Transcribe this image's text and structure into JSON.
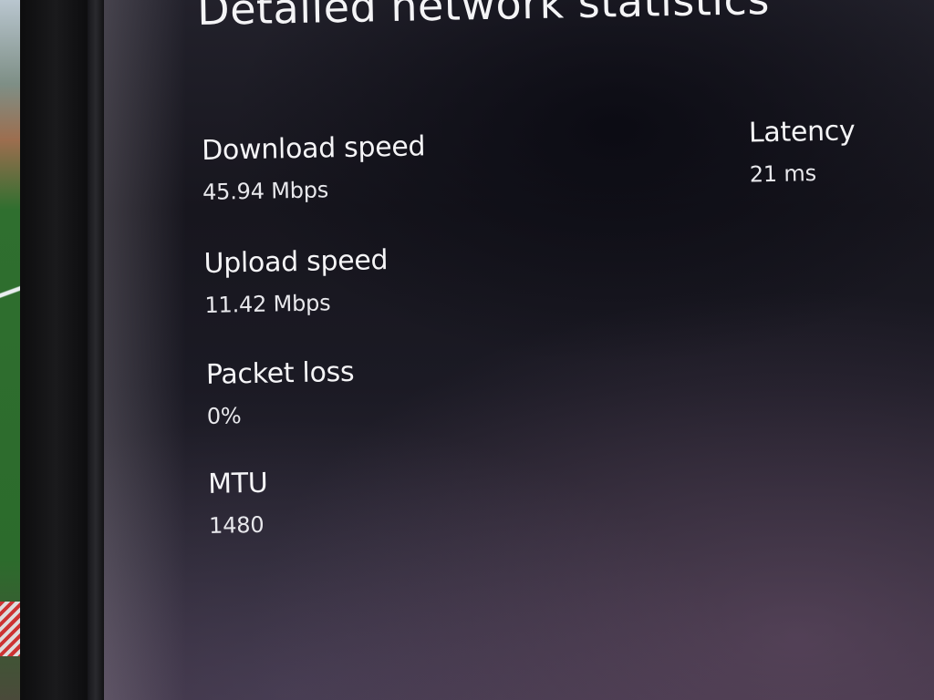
{
  "page": {
    "title": "Detailed network statistics"
  },
  "stats": {
    "download": {
      "label": "Download speed",
      "value": "45.94 Mbps"
    },
    "upload": {
      "label": "Upload speed",
      "value": "11.42 Mbps"
    },
    "packet_loss": {
      "label": "Packet loss",
      "value": "0%"
    },
    "mtu": {
      "label": "MTU",
      "value": "1480"
    },
    "latency": {
      "label": "Latency",
      "value": "21 ms"
    }
  },
  "colors": {
    "background": "#1b1a24",
    "text": "#f2f2f4"
  }
}
